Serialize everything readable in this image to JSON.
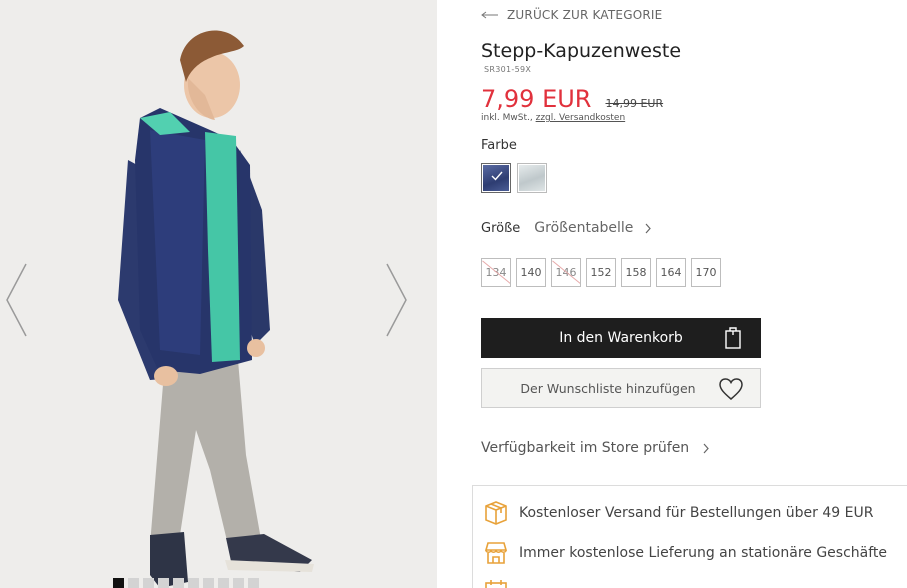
{
  "gallery": {
    "dots_total": 10,
    "active_dot": 0,
    "prev_icon": "chevron-left-icon",
    "next_icon": "chevron-right-icon"
  },
  "nav": {
    "back_label": "ZURÜCK ZUR KATEGORIE"
  },
  "product": {
    "title": "Stepp-Kapuzenweste",
    "sku": "SR301-59X",
    "price_new": "7,99 EUR",
    "price_old": "14,99 EUR",
    "tax_text": "inkl. MwSt.,",
    "shipping_link": "zzgl. Versandkosten",
    "price_color": "#e1313c"
  },
  "colors": {
    "label": "Farbe",
    "options": [
      {
        "name": "navy",
        "hex": "#3d4f85",
        "selected": true
      },
      {
        "name": "silver",
        "hex": "#cfd6d8",
        "selected": false
      }
    ]
  },
  "sizes": {
    "label": "Größe",
    "chart_label": "Größentabelle",
    "options": [
      {
        "value": "134",
        "available": false
      },
      {
        "value": "140",
        "available": true
      },
      {
        "value": "146",
        "available": false
      },
      {
        "value": "152",
        "available": true
      },
      {
        "value": "158",
        "available": true
      },
      {
        "value": "164",
        "available": true
      },
      {
        "value": "170",
        "available": true
      }
    ]
  },
  "actions": {
    "cart_label": "In den Warenkorb",
    "wishlist_label": "Der Wunschliste hinzufügen",
    "store_label": "Verfügbarkeit im Store prüfen"
  },
  "info": {
    "shipping": "Kostenloser Versand für Bestellungen über 49 EUR",
    "store_delivery": "Immer kostenlose Lieferung an stationäre Geschäfte",
    "icon_color": "#e8a23a"
  }
}
